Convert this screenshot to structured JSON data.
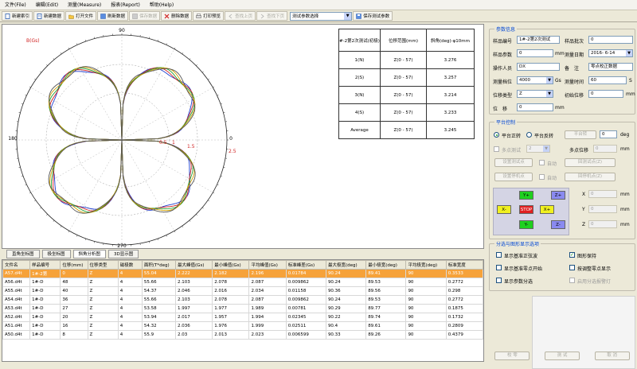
{
  "menu": [
    "文件(File)",
    "编辑(Edit)",
    "测量(Measure)",
    "报表(Report)",
    "帮助(Help)"
  ],
  "toolbar": {
    "buttons": [
      {
        "label": "新建索引",
        "enabled": true
      },
      {
        "label": "新建数据",
        "enabled": true
      },
      {
        "label": "打开文件",
        "enabled": true
      },
      {
        "label": "刷新数据",
        "enabled": true
      },
      {
        "label": "保存数据",
        "enabled": false
      },
      {
        "label": "删除数据",
        "enabled": true
      },
      {
        "label": "打印预览",
        "enabled": true
      },
      {
        "label": "查找上页",
        "enabled": false
      },
      {
        "label": "查找下页",
        "enabled": false
      }
    ],
    "test_param_select": "测试参数选择",
    "save_params": "保存测试参数"
  },
  "chart_data": {
    "type": "polar",
    "y_label": "B(Gs)",
    "angle_ticks": [
      "90",
      "180",
      "270",
      "0"
    ],
    "radial_ticks": [
      "0.5",
      "1",
      "1.5",
      "2.5"
    ],
    "series_count": 5,
    "series_colors": [
      "#1f3fd0",
      "#d01f1f",
      "#1f9f2f",
      "#d0a000",
      "#555555"
    ],
    "stats_table": {
      "headers": [
        "#-2第2次测试(初极)",
        "位移范围(mm)",
        "斜角(deg)-φ10mm"
      ],
      "rows": [
        [
          "1(N)",
          "Z(0 - 57)",
          "3.276"
        ],
        [
          "2(S)",
          "Z(0 - 57)",
          "3.257"
        ],
        [
          "3(N)",
          "Z(0 - 57)",
          "3.214"
        ],
        [
          "4(S)",
          "Z(0 - 57)",
          "3.233"
        ],
        [
          "Average",
          "Z(0 - 57)",
          "3.245"
        ]
      ]
    }
  },
  "tabs": [
    "直角坐标图",
    "极坐标图",
    "斜角分析图",
    "3D显示图"
  ],
  "active_tab": 2,
  "grid": {
    "headers": [
      "文件名",
      "样品编号",
      "位移(mm)",
      "位移类型",
      "磁极数",
      "面积(T*deg)",
      "最大峰值(Gs)",
      "最小峰值(Gs)",
      "平均峰值(Gs)",
      "标准峰差(Gs)",
      "最大极宽(deg)",
      "最小极宽(deg)",
      "平均极宽(deg)",
      "标准宽度"
    ],
    "rows": [
      [
        "A57.d4t",
        "1#-2第",
        "0",
        "Z",
        "4",
        "55.04",
        "2.222",
        "2.182",
        "2.196",
        "0.01784",
        "90.24",
        "89.41",
        "90",
        "0.3533"
      ],
      [
        "A56.d4t",
        "1#-D",
        "48",
        "Z",
        "4",
        "55.66",
        "2.103",
        "2.078",
        "2.087",
        "0.009862",
        "90.24",
        "89.53",
        "90",
        "0.2772"
      ],
      [
        "A55.d4t",
        "1#-D",
        "40",
        "Z",
        "4",
        "54.37",
        "2.046",
        "2.016",
        "2.034",
        "0.01158",
        "90.36",
        "89.56",
        "90",
        "0.298"
      ],
      [
        "A54.d4t",
        "1#-D",
        "36",
        "Z",
        "4",
        "55.66",
        "2.103",
        "2.078",
        "2.087",
        "0.009862",
        "90.24",
        "89.53",
        "90",
        "0.2772"
      ],
      [
        "A53.d4t",
        "1#-D",
        "27",
        "Z",
        "4",
        "53.58",
        "1.997",
        "1.977",
        "1.989",
        "0.00781",
        "90.29",
        "89.77",
        "90",
        "0.1875"
      ],
      [
        "A52.d4t",
        "1#-D",
        "20",
        "Z",
        "4",
        "53.94",
        "2.017",
        "1.957",
        "1.994",
        "0.02345",
        "90.22",
        "89.74",
        "90",
        "0.1732"
      ],
      [
        "A51.d4t",
        "1#-D",
        "16",
        "Z",
        "4",
        "54.32",
        "2.036",
        "1.976",
        "1.999",
        "0.02511",
        "90.4",
        "89.61",
        "90",
        "0.2809"
      ],
      [
        "A50.d4t",
        "1#-D",
        "8",
        "Z",
        "4",
        "55.9",
        "2.03",
        "2.013",
        "2.023",
        "0.006599",
        "90.33",
        "89.26",
        "90",
        "0.4379"
      ]
    ]
  },
  "params": {
    "title": "参数信息",
    "sample_no_label": "样品编号",
    "sample_no": "1#-2第2次测试",
    "batch_label": "样品批次",
    "batch": "0",
    "sample_param_label": "样品参数",
    "sample_param": "0",
    "sample_param_unit": "mm",
    "date_label": "测量日期",
    "date": "2016- 6-14",
    "operator_label": "操作人员",
    "operator": "DX",
    "note_label": "备　注",
    "note": "零点校正数据",
    "range_label": "测量档位",
    "range": "4000",
    "range_unit": "Gs",
    "time_label": "测量时间",
    "time": "60",
    "time_unit": "S",
    "disp_type_label": "位移类型",
    "disp_type": "Z",
    "init_disp_label": "初始位移",
    "init_disp": "0",
    "init_disp_unit": "mm",
    "disp_label": "位　移",
    "disp": "0",
    "disp_unit": "mm"
  },
  "platform": {
    "title": "平台控制",
    "forward": "平台正转",
    "reverse": "平台反转",
    "platform_btn": "平台转",
    "angle": "0",
    "angle_unit": "deg",
    "multipoint": "多点测试",
    "multipoint_val": "2",
    "multipoint_disp": "多点位移",
    "multipoint_disp_val": "0",
    "multipoint_disp_unit": "mm",
    "set_test_point": "设置测试点",
    "auto1": "自动",
    "return_test_point": "回测试点(Z)",
    "set_stop_point": "设置停机点",
    "auto2": "自动",
    "return_stop_point": "回停机点(Z)",
    "keys": {
      "yp": "Y+",
      "zp": "Z+",
      "xm": "X-",
      "stop": "STOP",
      "xp": "X+",
      "ym": "Y-",
      "zm": "Z-"
    },
    "x_label": "X",
    "y_label": "Y",
    "z_label": "Z",
    "x_val": "0",
    "y_val": "0",
    "z_val": "0",
    "unit": "mm"
  },
  "display_opts": {
    "title": "分选与图形显示选项",
    "opt1": "显示基准正弦波",
    "opt1_checked": false,
    "opt2": "图形保持",
    "opt2_checked": true,
    "opt3": "显示基准零点开始",
    "opt3_checked": false,
    "opt4": "按调整零点显示",
    "opt4_checked": false,
    "opt5": "显示参数分选",
    "opt5_checked": false,
    "opt6": "启用分选报警灯",
    "opt6_checked": false
  },
  "bottom_buttons": [
    "校 零",
    "测 试",
    "取 消"
  ]
}
